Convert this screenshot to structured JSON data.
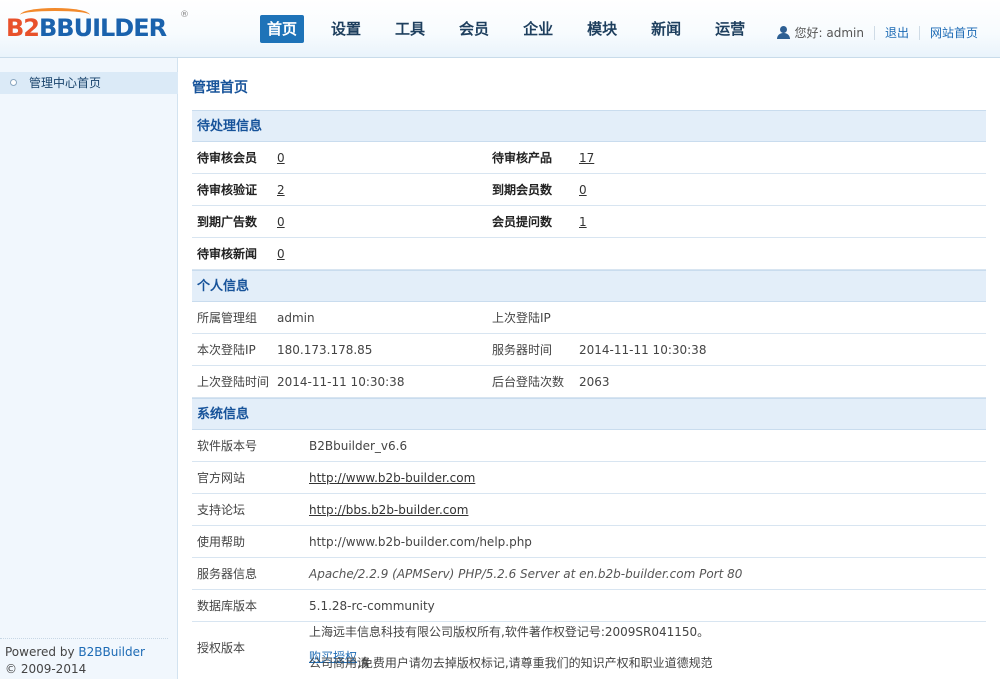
{
  "logo": {
    "prefix": "B",
    "mid": "2",
    "word": "BBUILDER",
    "reg": "®"
  },
  "nav": [
    {
      "label": "首页",
      "active": true
    },
    {
      "label": "设置"
    },
    {
      "label": "工具"
    },
    {
      "label": "会员"
    },
    {
      "label": "企业"
    },
    {
      "label": "模块"
    },
    {
      "label": "新闻"
    },
    {
      "label": "运营"
    }
  ],
  "userbar": {
    "greeting": "您好: admin",
    "logout": "退出",
    "site_home": "网站首页"
  },
  "sidebar": {
    "item": "管理中心首页",
    "powered_prefix": "Powered by ",
    "powered_link": "B2BBuilder",
    "copyright": "© 2009-2014"
  },
  "main": {
    "title": "管理首页",
    "pending": {
      "title": "待处理信息",
      "rows": [
        {
          "l1": "待审核会员",
          "v1": "0",
          "l2": "待审核产品",
          "v2": "17"
        },
        {
          "l1": "待审核验证",
          "v1": "2",
          "l2": "到期会员数",
          "v2": "0"
        },
        {
          "l1": "到期广告数",
          "v1": "0",
          "l2": "会员提问数",
          "v2": "1"
        },
        {
          "l1": "待审核新闻",
          "v1": "0"
        }
      ]
    },
    "personal": {
      "title": "个人信息",
      "rows": [
        {
          "l1": "所属管理组",
          "v1": "admin",
          "l2": "上次登陆IP",
          "v2": ""
        },
        {
          "l1": "本次登陆IP",
          "v1": "180.173.178.85",
          "l2": "服务器时间",
          "v2": "2014-11-11 10:30:38"
        },
        {
          "l1": "上次登陆时间",
          "v1": "2014-11-11 10:30:38",
          "l2": "后台登陆次数",
          "v2": "2063"
        }
      ]
    },
    "system": {
      "title": "系统信息",
      "version_label": "软件版本号",
      "version": "B2Bbuilder_v6.6",
      "official_label": "官方网站",
      "official": "http://www.b2b-builder.com",
      "forum_label": "支持论坛",
      "forum": "http://bbs.b2b-builder.com",
      "help_label": "使用帮助",
      "help": "http://www.b2b-builder.com/help.php",
      "server_label": "服务器信息",
      "server": "Apache/2.2.9 (APMServ) PHP/5.2.6 Server at en.b2b-builder.com Port 80",
      "db_label": "数据库版本",
      "db": "5.1.28-rc-community",
      "license_label": "授权版本",
      "license_line1": "上海远丰信息科技有限公司版权所有,软件著作权登记号:2009SR041150。",
      "license_line2_pre": "公司商用请",
      "license_line2_link": "购买授权",
      "license_line2_post": ",免费用户请勿去掉版权标记,请尊重我们的知识产权和职业道德规范"
    }
  }
}
